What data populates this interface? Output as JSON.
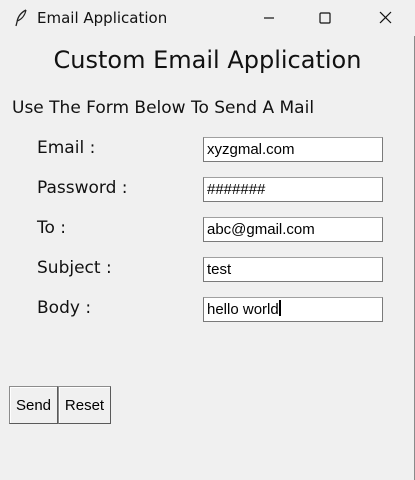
{
  "window": {
    "title": "Email Application",
    "icons": {
      "app": "feather-icon",
      "minimize": "minimize-icon",
      "maximize": "maximize-icon",
      "close": "close-icon"
    }
  },
  "main": {
    "heading": "Custom Email Application",
    "subheading": "Use The Form Below To Send A Mail"
  },
  "form": {
    "fields": [
      {
        "label": "Email :",
        "value": "xyzgmal.com"
      },
      {
        "label": "Password :",
        "value": "#######"
      },
      {
        "label": "To :",
        "value": "abc@gmail.com"
      },
      {
        "label": "Subject :",
        "value": "test"
      },
      {
        "label": "Body :",
        "value": "hello world"
      }
    ]
  },
  "buttons": {
    "send": "Send",
    "reset": "Reset"
  }
}
